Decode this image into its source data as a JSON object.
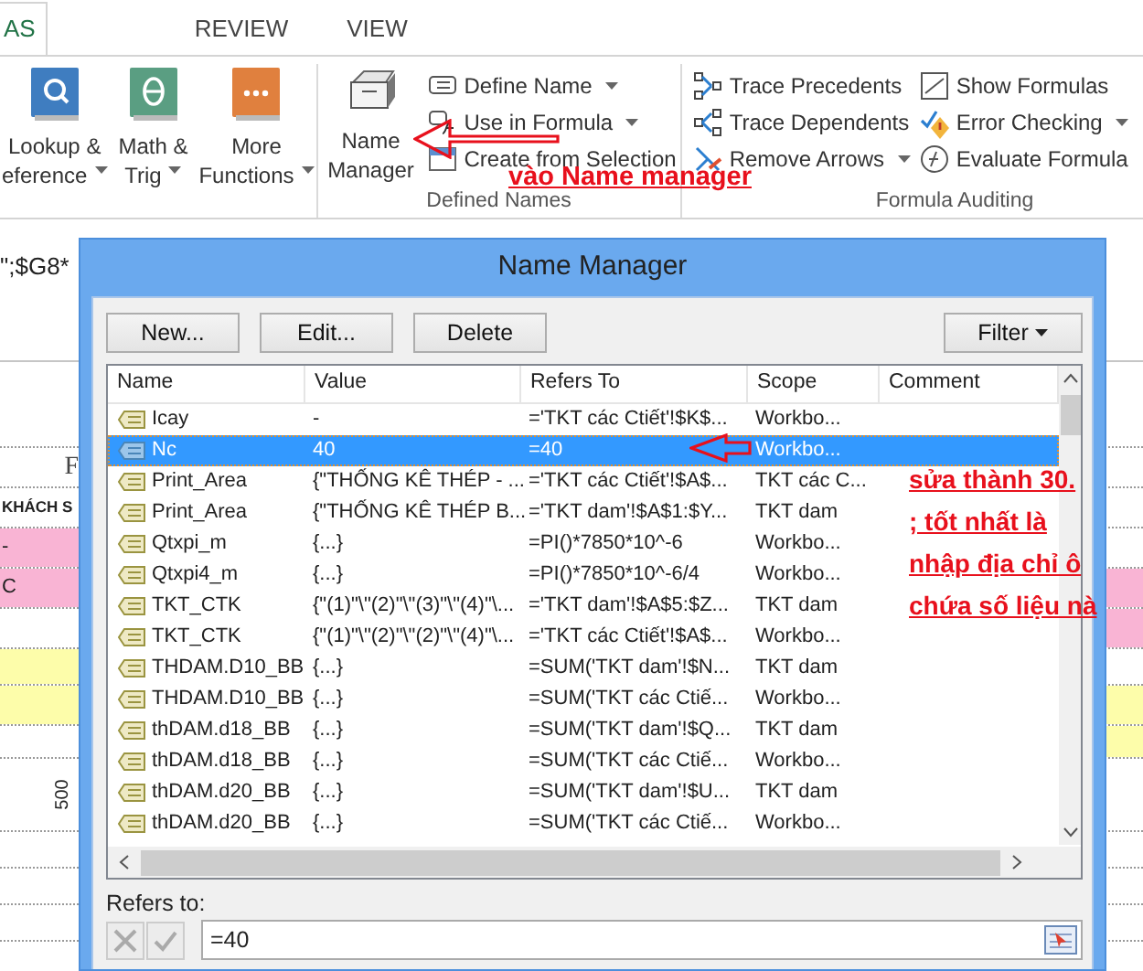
{
  "ribbon": {
    "tabs": [
      {
        "label": "AS",
        "selected": true
      },
      {
        "label": "REVIEW",
        "selected": false
      },
      {
        "label": "VIEW",
        "selected": false
      }
    ],
    "function_buttons": [
      {
        "kind": "lookup",
        "lines": [
          "Lookup &",
          "eference"
        ],
        "dropdown": true
      },
      {
        "kind": "math",
        "lines": [
          "Math &",
          "Trig"
        ],
        "dropdown": true
      },
      {
        "kind": "more",
        "lines": [
          "More",
          "Functions"
        ],
        "dropdown": true
      }
    ],
    "defined_names": {
      "name_manager": [
        "Name",
        "Manager"
      ],
      "items": [
        {
          "kind": "define",
          "label": "Define Name",
          "dropdown": true
        },
        {
          "kind": "use",
          "label": "Use in Formula",
          "dropdown": true
        },
        {
          "kind": "create",
          "label": "Create from Selection",
          "dropdown": false
        }
      ],
      "label": "Defined Names"
    },
    "formula_auditing": {
      "items": [
        {
          "kind": "precedents",
          "label": "Trace Precedents",
          "dropdown": false
        },
        {
          "kind": "show",
          "label": "Show Formulas",
          "dropdown": false
        },
        {
          "kind": "dependents",
          "label": "Trace Dependents",
          "dropdown": false
        },
        {
          "kind": "error",
          "label": "Error Checking",
          "dropdown": true
        },
        {
          "kind": "remove",
          "label": "Remove Arrows",
          "dropdown": true
        },
        {
          "kind": "evaluate",
          "label": "Evaluate Formula",
          "dropdown": false
        }
      ],
      "label": "Formula Auditing"
    }
  },
  "formula_bar": {
    "text": "\";$G8*"
  },
  "sheet": {
    "texts": [
      {
        "kind": "header",
        "text": "F"
      },
      {
        "kind": "bold",
        "text": "KHÁCH S"
      },
      {
        "kind": "plain",
        "text": "-"
      },
      {
        "kind": "plain",
        "text": "C"
      },
      {
        "kind": "vertical",
        "text": "500"
      }
    ]
  },
  "dialog": {
    "title": "Name Manager",
    "buttons": [
      "New...",
      "Edit...",
      "Delete"
    ],
    "filter": "Filter",
    "columns": [
      "Name",
      "Value",
      "Refers To",
      "Scope",
      "Comment"
    ],
    "rows": [
      {
        "name": "Icay",
        "value": "-",
        "refers_to": "='TKT các Ctiết'!$K$...",
        "scope": "Workbo...",
        "selected": false
      },
      {
        "name": "Nc",
        "value": "40",
        "refers_to": "=40",
        "scope": "Workbo...",
        "selected": true
      },
      {
        "name": "Print_Area",
        "value": "{\"THỐNG KÊ THÉP - ...",
        "refers_to": "='TKT các Ctiết'!$A$...",
        "scope": "TKT các C...",
        "selected": false
      },
      {
        "name": "Print_Area",
        "value": "{\"THỐNG KÊ THÉP B...",
        "refers_to": "='TKT dam'!$A$1:$Y...",
        "scope": "TKT dam",
        "selected": false
      },
      {
        "name": "Qtxpi_m",
        "value": "{...}",
        "refers_to": "=PI()*7850*10^-6",
        "scope": "Workbo...",
        "selected": false
      },
      {
        "name": "Qtxpi4_m",
        "value": "{...}",
        "refers_to": "=PI()*7850*10^-6/4",
        "scope": "Workbo...",
        "selected": false
      },
      {
        "name": "TKT_CTK",
        "value": "{\"(1)\"\\\"(2)\"\\\"(3)\"\\\"(4)\"\\...",
        "refers_to": "='TKT dam'!$A$5:$Z...",
        "scope": "TKT dam",
        "selected": false
      },
      {
        "name": "TKT_CTK",
        "value": "{\"(1)\"\\\"(2)\"\\\"(2)\"\\\"(4)\"\\...",
        "refers_to": "='TKT các Ctiết'!$A$...",
        "scope": "Workbo...",
        "selected": false
      },
      {
        "name": "THDAM.D10_BB",
        "value": "{...}",
        "refers_to": "=SUM('TKT dam'!$N...",
        "scope": "TKT dam",
        "selected": false
      },
      {
        "name": "THDAM.D10_BB",
        "value": "{...}",
        "refers_to": "=SUM('TKT các Ctiế...",
        "scope": "Workbo...",
        "selected": false
      },
      {
        "name": "thDAM.d18_BB",
        "value": "{...}",
        "refers_to": "=SUM('TKT dam'!$Q...",
        "scope": "TKT dam",
        "selected": false
      },
      {
        "name": "thDAM.d18_BB",
        "value": "{...}",
        "refers_to": "=SUM('TKT các Ctiế...",
        "scope": "Workbo...",
        "selected": false
      },
      {
        "name": "thDAM.d20_BB",
        "value": "{...}",
        "refers_to": "=SUM('TKT dam'!$U...",
        "scope": "TKT dam",
        "selected": false
      },
      {
        "name": "thDAM.d20_BB",
        "value": "{...}",
        "refers_to": "=SUM('TKT các Ctiế...",
        "scope": "Workbo...",
        "selected": false
      }
    ],
    "refers_to_label": "Refers to:",
    "refers_to_value": "=40"
  },
  "annotations": [
    {
      "kind": "ribbon",
      "lines": [
        "vào Name manager"
      ]
    },
    {
      "kind": "row",
      "lines": [
        "sửa thành 30.",
        "; tốt nhất là",
        "nhập địa chỉ ô",
        "chứa số liệu nà"
      ]
    }
  ]
}
